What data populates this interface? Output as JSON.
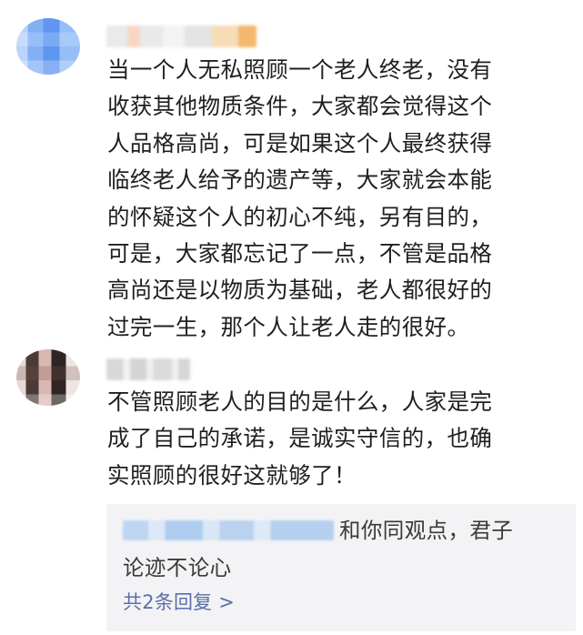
{
  "comments": [
    {
      "username": "",
      "text": "当一个人无私照顾一个老人终老，没有\n收获其他物质条件，大家都会觉得这个\n人品格高尚，可是如果这个人最终获得\n临终老人给予的遗产等，大家就会本能\n的怀疑这个人的初心不纯，另有目的，\n可是，大家都忘记了一点，不管是品格\n高尚还是以物质为基础，老人都很好的\n过完一生，那个人让老人走的很好。"
    },
    {
      "username": "",
      "text": "不管照顾老人的目的是什么，人家是完\n成了自己的承诺，是诚实守信的，也确\n实照顾的很好这就够了！",
      "reply": {
        "text": "和你同观点，君子\n论迹不论心",
        "more": "共2条回复 >"
      }
    }
  ]
}
